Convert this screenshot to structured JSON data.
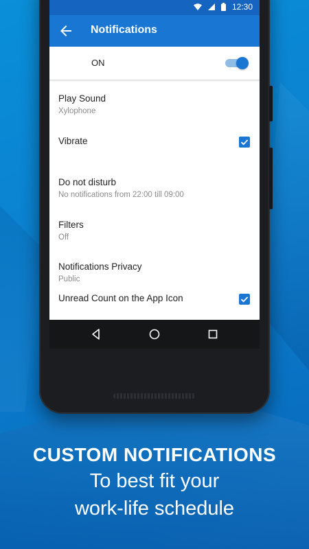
{
  "status_bar": {
    "time": "12:30",
    "icons": [
      "wifi-icon",
      "signal-icon",
      "battery-icon"
    ]
  },
  "app_bar": {
    "title": "Notifications",
    "back_icon": "arrow-back-icon"
  },
  "master_toggle": {
    "label": "ON",
    "checked": true
  },
  "settings": [
    {
      "title": "Play Sound",
      "subtitle": "Xylophone"
    },
    {
      "title": "Vibrate",
      "checked": true
    },
    {
      "title": "Do not disturb",
      "subtitle": "No notifications from 22:00 till 09:00"
    },
    {
      "title": "Filters",
      "subtitle": "Off"
    },
    {
      "title": "Notifications Privacy",
      "subtitle": "Public"
    },
    {
      "title": "Unread Count on the App Icon",
      "checked": true
    }
  ],
  "nav_bar": {
    "icons": [
      "back-triangle-icon",
      "home-circle-icon",
      "recents-square-icon"
    ]
  },
  "caption": {
    "heading": "CUSTOM NOTIFICATIONS",
    "line1": "To best fit your",
    "line2": "work-life schedule"
  },
  "colors": {
    "background": "#0b7fcf",
    "app_bar": "#1976d2",
    "status_bar": "#1565c0",
    "accent": "#1976d2"
  }
}
